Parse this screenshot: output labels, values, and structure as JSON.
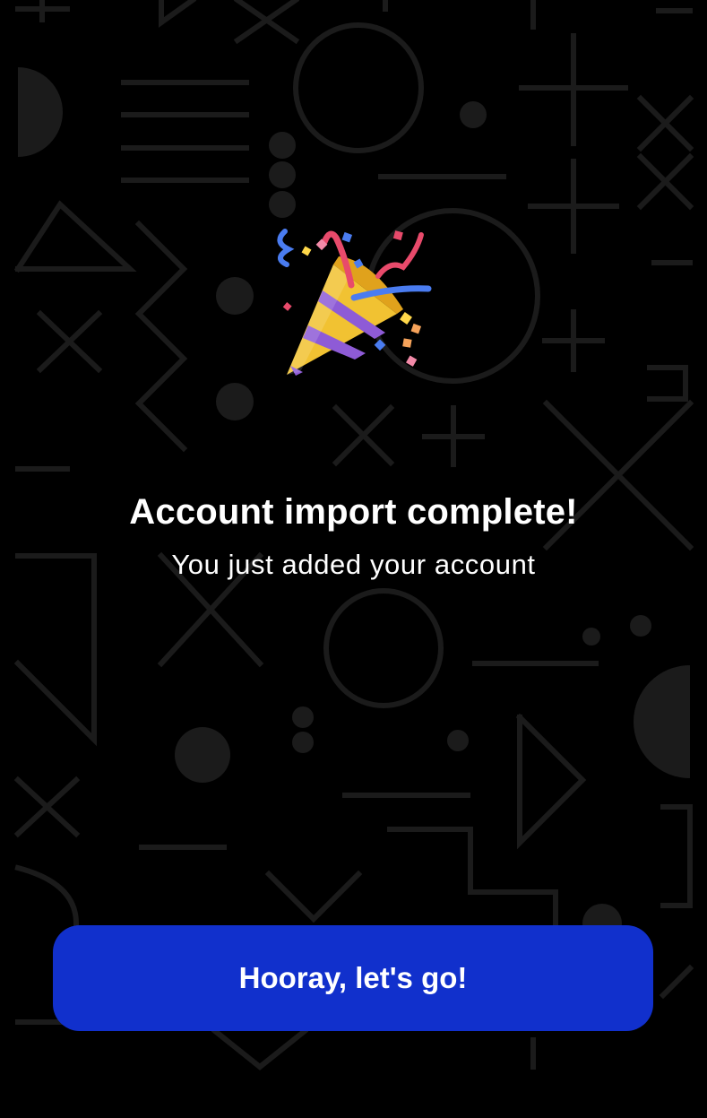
{
  "celebration": {
    "icon": "party-popper-icon"
  },
  "message": {
    "title": "Account import complete!",
    "subtitle": "You just added your account"
  },
  "actions": {
    "primary_label": "Hooray, let's go!"
  },
  "colors": {
    "background": "#000000",
    "pattern": "#1b1b1b",
    "button": "#1130cc",
    "text": "#ffffff"
  }
}
